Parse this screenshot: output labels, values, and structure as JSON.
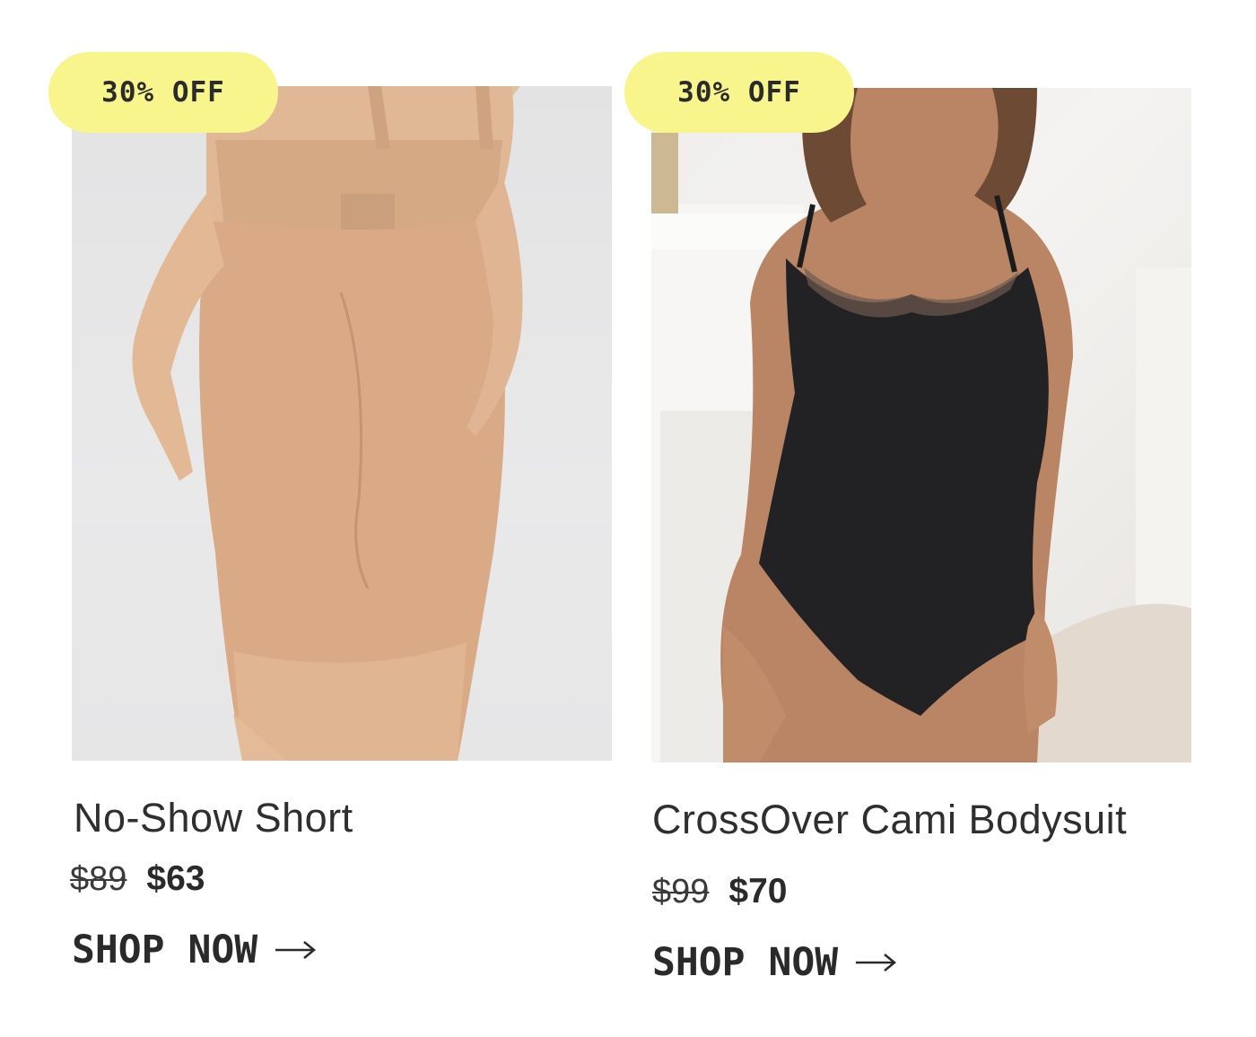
{
  "products": [
    {
      "badge": "30% OFF",
      "name": "No-Show Short",
      "price_original": "$89",
      "price_sale": "$63",
      "cta": "SHOP NOW",
      "image_icon": "product-photo-shapewear-short",
      "colors": {
        "garment": "#dcae8a",
        "background": "#e6e6e7"
      }
    },
    {
      "badge": "30% OFF",
      "name": "CrossOver Cami Bodysuit",
      "price_original": "$99",
      "price_sale": "$70",
      "cta": "SHOP NOW",
      "image_icon": "product-photo-bodysuit",
      "colors": {
        "garment": "#222225",
        "background": "#efeeec"
      }
    }
  ],
  "colors": {
    "badge_background": "#f7f58b",
    "text": "#2a2a2a"
  }
}
